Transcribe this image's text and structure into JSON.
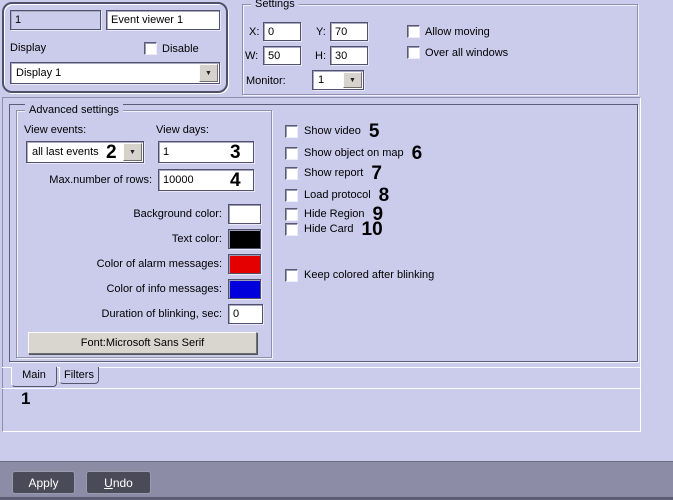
{
  "window": {
    "bg": "#cbcbec"
  },
  "icons": {
    "dropdown_arrow": "▼"
  },
  "identity": {
    "id_value": "1",
    "name_value": "Event viewer 1",
    "display_label": "Display",
    "disable_label": "Disable",
    "display_value": "Display 1"
  },
  "settings": {
    "title": "Settings",
    "x_label": "X:",
    "x_value": "0",
    "y_label": "Y:",
    "y_value": "70",
    "w_label": "W:",
    "w_value": "50",
    "h_label": "H:",
    "h_value": "30",
    "allow_moving_label": "Allow moving",
    "over_all_windows_label": "Over all windows",
    "monitor_label": "Monitor:",
    "monitor_value": "1"
  },
  "advanced": {
    "title": "Advanced settings",
    "view_events_label": "View events:",
    "view_events_value": "all last events",
    "view_days_label": "View days:",
    "view_days_value": "1",
    "max_rows_label": "Max.number of rows:",
    "max_rows_value": "10000",
    "color_rows": [
      {
        "label": "Background color:",
        "color": "#ffffff"
      },
      {
        "label": "Text color:",
        "color": "#000000"
      },
      {
        "label": "Color of alarm messages:",
        "color": "#e40000"
      },
      {
        "label": "Color of info messages:",
        "color": "#0000dc"
      }
    ],
    "blink_label": "Duration of blinking, sec:",
    "blink_value": "0",
    "font_button_label": "Font:Microsoft Sans Serif"
  },
  "options": {
    "checkboxes": [
      {
        "label": "Show video",
        "annotation": "5"
      },
      {
        "label": "Show object on map",
        "annotation": "6"
      },
      {
        "label": "Show report",
        "annotation": "7"
      },
      {
        "label": "Load protocol",
        "annotation": "8"
      },
      {
        "label": "Hide Region",
        "annotation": "9"
      },
      {
        "label": "Hide Card",
        "annotation": "10"
      }
    ],
    "keep_colored_label": "Keep colored after blinking"
  },
  "annotations": {
    "view_events": "2",
    "view_days": "3",
    "max_rows": "4",
    "main_tab": "1"
  },
  "tabs": {
    "main": "Main",
    "filters": "Filters"
  },
  "footer": {
    "apply": "Apply",
    "undo": "Undo"
  }
}
